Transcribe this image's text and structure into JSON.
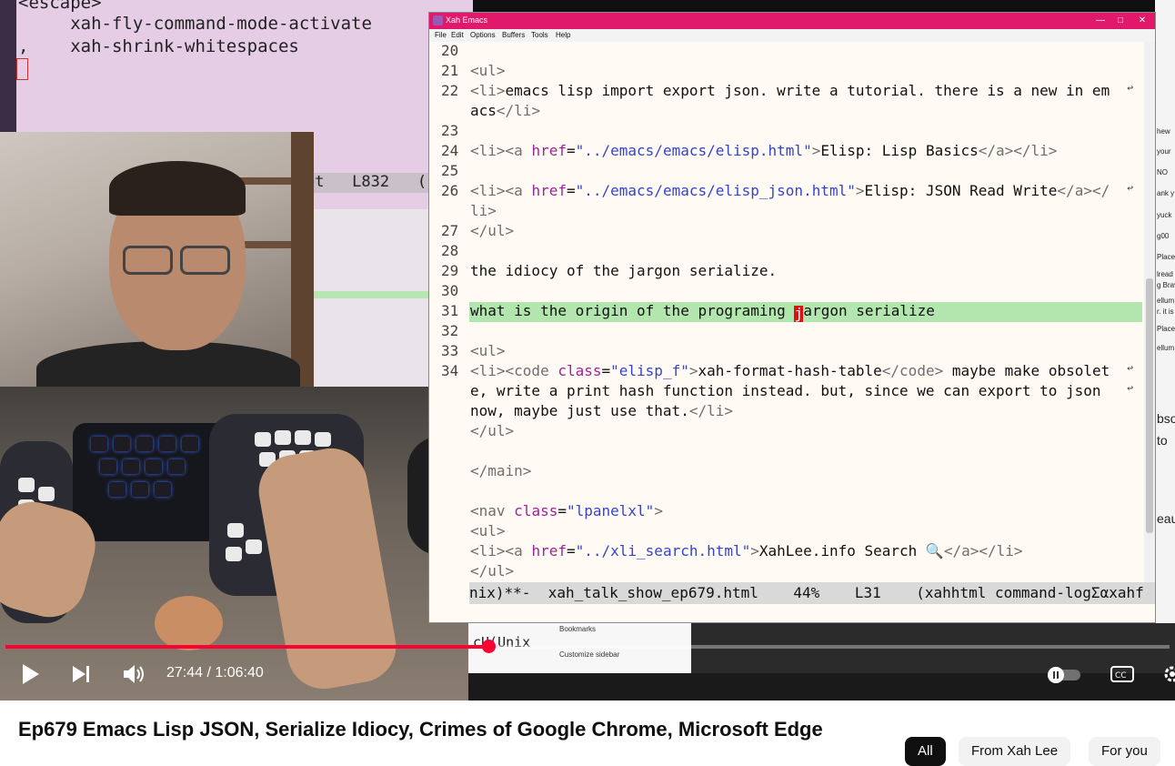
{
  "video": {
    "title": "Ep679 Emacs Lisp JSON, Serialize Idiocy, Crimes of Google Chrome, Microsoft Edge",
    "time": "27:44 / 1:06:40",
    "progress_fraction": 0.416
  },
  "chips": {
    "all": "All",
    "from": "From Xah Lee",
    "foryou": "For you"
  },
  "bg_emacs": {
    "line1": "<escape>",
    "line2": "     xah-fly-command-mode-activate",
    "line3": ",    xah-shrink-whitespaces",
    "modeline": "pt   L832   ("
  },
  "emacs": {
    "title": "Xah Emacs",
    "menu": [
      "File",
      "Edit",
      "Options",
      "Buffers",
      "Tools",
      "Help"
    ],
    "modeline": "nix)**-  xah_talk_show_ep679.html    44%    L31    (xahhtml command-logΣαxahf"
  },
  "bg_right_texts": [
    "hew",
    "your",
    "NO",
    "ank y",
    "yuck",
    "g00",
    "Place",
    "lread",
    "g Brav",
    "ellum",
    "r. it is",
    "Place",
    "ellum",
    "bso",
    "to",
    "eau"
  ],
  "bg_browser": {
    "bookmarks": "Bookmarks",
    "customize": "Customize sidebar",
    "frag": "cU(Unix"
  },
  "colors": {
    "emacs_titlebar": "#e0196b",
    "highlight_line": "#b3e6ae",
    "progress": "#ff0033"
  }
}
